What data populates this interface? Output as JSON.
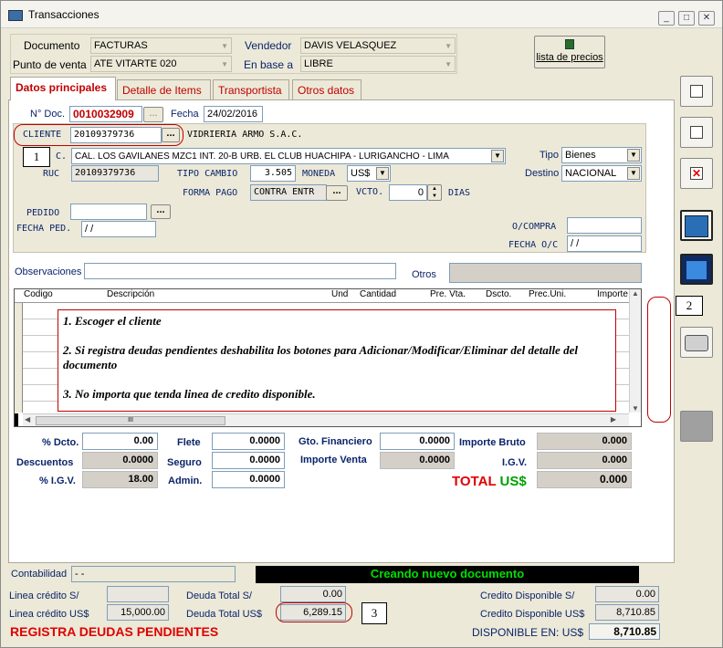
{
  "window": {
    "title": "Transacciones"
  },
  "header": {
    "documento_label": "Documento",
    "documento_value": "FACTURAS",
    "punto_venta_label": "Punto de venta",
    "punto_venta_value": "ATE VITARTE 020",
    "vendedor_label": "Vendedor",
    "vendedor_value": "DAVIS VELASQUEZ",
    "en_base_label": "En base a",
    "en_base_value": "LIBRE",
    "lista_precios_label": "lista de precios"
  },
  "tabs": [
    "Datos principales",
    "Detalle de Items",
    "Transportista",
    "Otros datos"
  ],
  "form": {
    "ndoc_label": "N° Doc.",
    "ndoc_value": "0010032909",
    "fecha_label": "Fecha",
    "fecha_value": "24/02/2016",
    "cliente_label": "CLIENTE",
    "cliente_value": "20109379736",
    "cliente_nombre": "VIDRIERIA ARMO S.A.C.",
    "dir_label": "C.",
    "dir_value": "CAL. LOS GAVILANES MZC1 INT. 20-B URB. EL CLUB HUACHIPA - LURIGANCHO - LIMA",
    "ruc_label": "RUC",
    "ruc_value": "20109379736",
    "tipo_cambio_label": "TIPO CAMBIO",
    "tipo_cambio_value": "3.505",
    "moneda_label": "MONEDA",
    "moneda_value": "US$",
    "forma_pago_label": "FORMA PAGO",
    "forma_pago_value": "CONTRA ENTR",
    "vcto_label": "VCTO.",
    "vcto_value": "0",
    "dias_label": "DIAS",
    "tipo_label": "Tipo",
    "tipo_value": "Bienes",
    "destino_label": "Destino",
    "destino_value": "NACIONAL",
    "pedido_label": "PEDIDO",
    "fecha_ped_label": "FECHA PED.",
    "fecha_ped_value": " /  /",
    "ocompra_label": "O/COMPRA",
    "fecha_oc_label": "FECHA O/C",
    "fecha_oc_value": " /  /",
    "observaciones_label": "Observaciones",
    "otros_label": "Otros",
    "ellipsis": "..."
  },
  "grid": {
    "columns": [
      "Codigo",
      "Descripción",
      "Und",
      "Cantidad",
      "Pre. Vta.",
      "Dscto.",
      "Prec.Uni.",
      "Importe"
    ],
    "scroll_marker": "III"
  },
  "annotation": {
    "line1": "1. Escoger el cliente",
    "line2": "2. Si registra deudas pendientes deshabilita los botones para Adicionar/Modificar/Eliminar del detalle del documento",
    "line3": "3. No importa que tenda linea de credito disponible.",
    "badge1": "1",
    "badge2": "2",
    "badge3": "3"
  },
  "totals": {
    "dcto_label": "% Dcto.",
    "dcto_value": "0.00",
    "descuentos_label": "Descuentos",
    "descuentos_value": "0.0000",
    "igv_pct_label": "% I.G.V.",
    "igv_pct_value": "18.00",
    "flete_label": "Flete",
    "flete_value": "0.0000",
    "seguro_label": "Seguro",
    "seguro_value": "0.0000",
    "admin_label": "Admin.",
    "admin_value": "0.0000",
    "gto_fin_label": "Gto. Financiero",
    "gto_fin_value": "0.0000",
    "importe_venta_label": "Importe Venta",
    "importe_venta_value": "0.0000",
    "importe_bruto_label": "Importe Bruto",
    "importe_bruto_value": "0.000",
    "igv_label": "I.G.V.",
    "igv_value": "0.000",
    "total_label": "TOTAL",
    "total_currency": "US$",
    "total_value": "0.000"
  },
  "status": {
    "contabilidad_label": "Contabilidad",
    "contabilidad_value": "-  -",
    "message": "Creando nuevo documento"
  },
  "credit": {
    "linea_s_label": "Linea crédito S/",
    "linea_s_value": "",
    "linea_usd_label": "Linea crédito  US$",
    "linea_usd_value": "15,000.00",
    "deuda_s_label": "Deuda Total  S/",
    "deuda_s_value": "0.00",
    "deuda_usd_label": "Deuda Total US$",
    "deuda_usd_value": "6,289.15",
    "cred_s_label": "Credito Disponible  S/",
    "cred_s_value": "0.00",
    "cred_usd_label": "Credito Disponible  US$",
    "cred_usd_value": "8,710.85",
    "disp_label": "DISPONIBLE EN: US$",
    "disp_value": "8,710.85",
    "warning": "REGISTRA DEUDAS PENDIENTES"
  },
  "colors": {
    "accent_red": "#c00000",
    "status_green": "#00e000",
    "label_blue": "#0a246a",
    "total_green": "#00a000"
  }
}
